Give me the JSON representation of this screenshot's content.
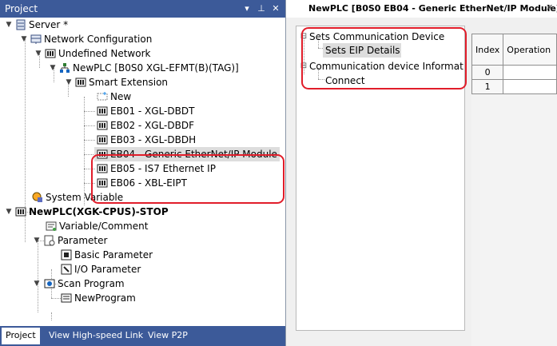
{
  "project_pane": {
    "title": "Project",
    "btn_dropdown": "▾",
    "btn_pin": "⊥",
    "btn_close": "✕",
    "tree": {
      "server": "Server *",
      "network_configuration": "Network Configuration",
      "undefined_network": "Undefined Network",
      "newplc_net": "NewPLC [B0S0 XGL-EFMT(B)(TAG)]",
      "smart_extension": "Smart Extension",
      "new": "New",
      "eb01": "EB01 - XGL-DBDT",
      "eb02": "EB02 - XGL-DBDF",
      "eb03": "EB03 - XGL-DBDH",
      "eb04": "EB04 - Generic EtherNet/IP Module",
      "eb05": "EB05 - IS7 Ethernet IP",
      "eb06": "EB06 - XBL-EIPT",
      "system_variable": "System Variable",
      "newplc_cpu": "NewPLC(XGK-CPUS)-STOP",
      "variable_comment": "Variable/Comment",
      "parameter": "Parameter",
      "basic_parameter": "Basic Parameter",
      "io_parameter": "I/O Parameter",
      "scan_program": "Scan Program",
      "new_program": "NewProgram"
    },
    "bottom_tabs": [
      "Project",
      "View High-speed Link",
      "View P2P"
    ]
  },
  "document": {
    "tab_title": "NewPLC [B0S0 EB04 - Generic EtherNet/IP Module]",
    "tab_close": "✕",
    "settings_tree": {
      "sets_comm_device": "Sets Communication Device",
      "sets_eip_details": "Sets EIP Details",
      "comm_device_info": "Communication device Informat",
      "connect": "Connect"
    },
    "grid": {
      "headers": [
        "Index",
        "Operation"
      ],
      "rows": [
        "0",
        "1"
      ]
    }
  },
  "colors": {
    "pane_header": "#3c5a99",
    "highlight_red": "#e11d2a",
    "selection": "#dddddd"
  }
}
